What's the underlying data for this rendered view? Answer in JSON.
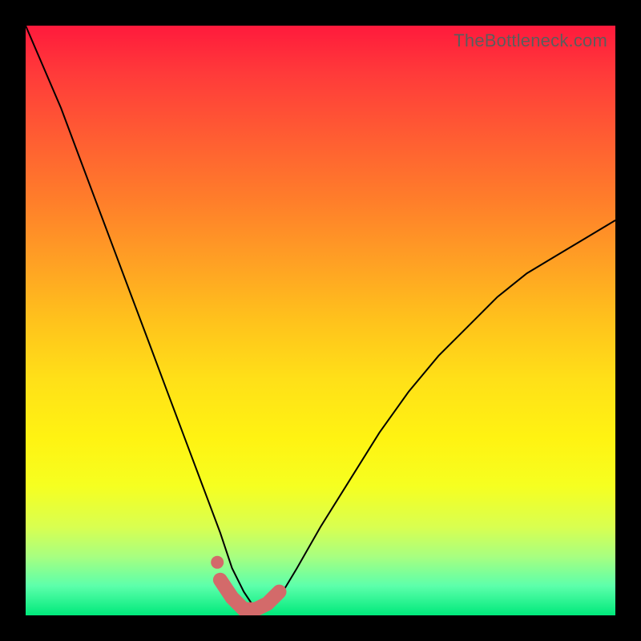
{
  "watermark": "TheBottleneck.com",
  "chart_data": {
    "type": "line",
    "title": "",
    "xlabel": "",
    "ylabel": "",
    "xlim": [
      0,
      100
    ],
    "ylim": [
      0,
      100
    ],
    "grid": false,
    "legend": false,
    "note": "Bottleneck-style curve; y≈0 is optimal (green), y≈100 is worst (red). Values estimated from pixels.",
    "series": [
      {
        "name": "bottleneck-curve",
        "x": [
          0,
          3,
          6,
          9,
          12,
          15,
          18,
          21,
          24,
          27,
          30,
          33,
          35,
          37,
          39,
          41,
          43,
          46,
          50,
          55,
          60,
          65,
          70,
          75,
          80,
          85,
          90,
          95,
          100
        ],
        "y": [
          100,
          93,
          86,
          78,
          70,
          62,
          54,
          46,
          38,
          30,
          22,
          14,
          8,
          4,
          1,
          1,
          3,
          8,
          15,
          23,
          31,
          38,
          44,
          49,
          54,
          58,
          61,
          64,
          67
        ]
      },
      {
        "name": "highlight-band",
        "x": [
          33,
          35,
          37,
          39,
          41,
          43
        ],
        "y": [
          6,
          3,
          1,
          1,
          2,
          4
        ]
      }
    ],
    "highlight_dot": {
      "x": 32.5,
      "y": 9
    },
    "gradient_stops": [
      {
        "pos": 0,
        "color": "#ff1a3c"
      },
      {
        "pos": 50,
        "color": "#ffc21c"
      },
      {
        "pos": 78,
        "color": "#f6ff20"
      },
      {
        "pos": 100,
        "color": "#00e97b"
      }
    ]
  }
}
